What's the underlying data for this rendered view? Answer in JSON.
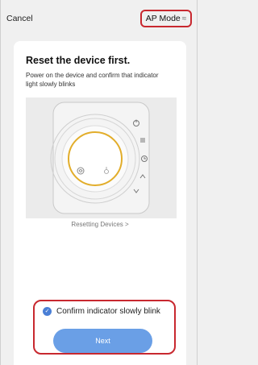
{
  "header": {
    "cancel_label": "Cancel",
    "ap_mode_label": "AP Mode",
    "ap_mode_icon": "wifi-icon"
  },
  "content": {
    "title": "Reset the device first.",
    "description": "Power on the device and confirm that indicator light slowly blinks",
    "resetting_link": "Resetting Devices >",
    "confirm_label": "Confirm indicator slowly blink",
    "confirm_checked": true,
    "next_label": "Next"
  },
  "colors": {
    "accent_blue": "#4a7fd6",
    "button_blue": "#6a9fe6",
    "highlight_red": "#c8282f",
    "ring_yellow": "#e2ad2a"
  },
  "device_icons": [
    "power-icon",
    "heat-icon",
    "clock-icon",
    "arrow-up-icon",
    "arrow-down-icon",
    "fan-icon",
    "thermostat-icon"
  ]
}
